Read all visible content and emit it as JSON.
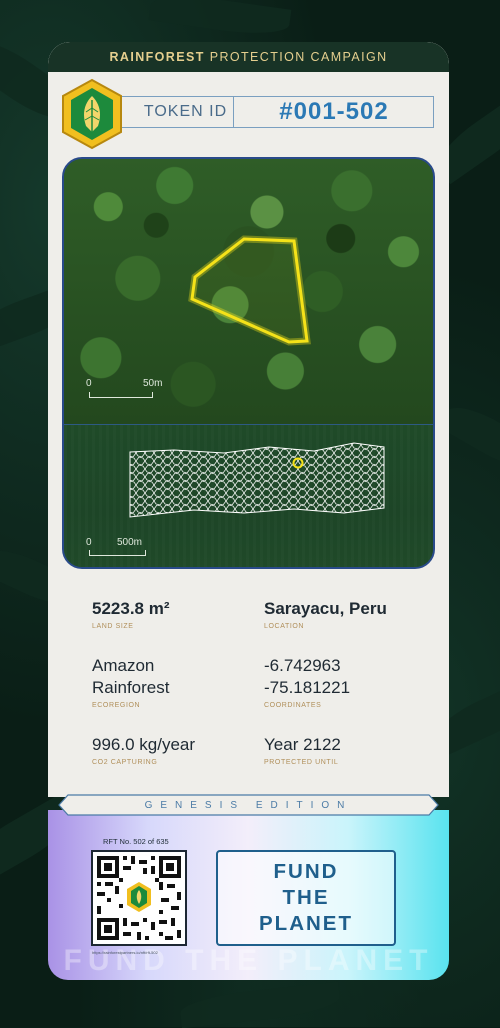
{
  "header": {
    "campaign_bold": "RAINFOREST",
    "campaign_rest": "PROTECTION CAMPAIGN",
    "token_label": "TOKEN ID",
    "token_value": "#001-502"
  },
  "map": {
    "top_scale_start": "0",
    "top_scale_end": "50m",
    "bottom_scale_start": "0",
    "bottom_scale_end": "500m"
  },
  "details": {
    "land_size": {
      "value": "5223.8 m²",
      "label": "LAND SIZE"
    },
    "location": {
      "value": "Sarayacu, Peru",
      "label": "LOCATION"
    },
    "ecoregion": {
      "value_line1": "Amazon",
      "value_line2": "Rainforest",
      "label": "ECOREGION"
    },
    "coordinates": {
      "lat": "-6.742963",
      "lon": "-75.181221",
      "label": "COORDINATES"
    },
    "co2": {
      "value": "996.0 kg/year",
      "label": "CO2 CAPTURING"
    },
    "protected": {
      "value": "Year 2122",
      "label": "PROTECTED UNTIL"
    }
  },
  "edition": "GENESIS EDITION",
  "footer": {
    "rft_number": "RFT No. 502 of 635",
    "qr_url": "https://rainforestpartners.io/nft/rft-502",
    "cta_line1": "FUND",
    "cta_line2": "THE",
    "cta_line3": "PLANET",
    "watermark": "FUND THE PLANET"
  },
  "colors": {
    "accent": "#2b79b5",
    "banner_bg": "#183326",
    "banner_text": "#e5cf8f",
    "plot_outline": "#f5e21a",
    "card_bg": "#efeeea"
  }
}
